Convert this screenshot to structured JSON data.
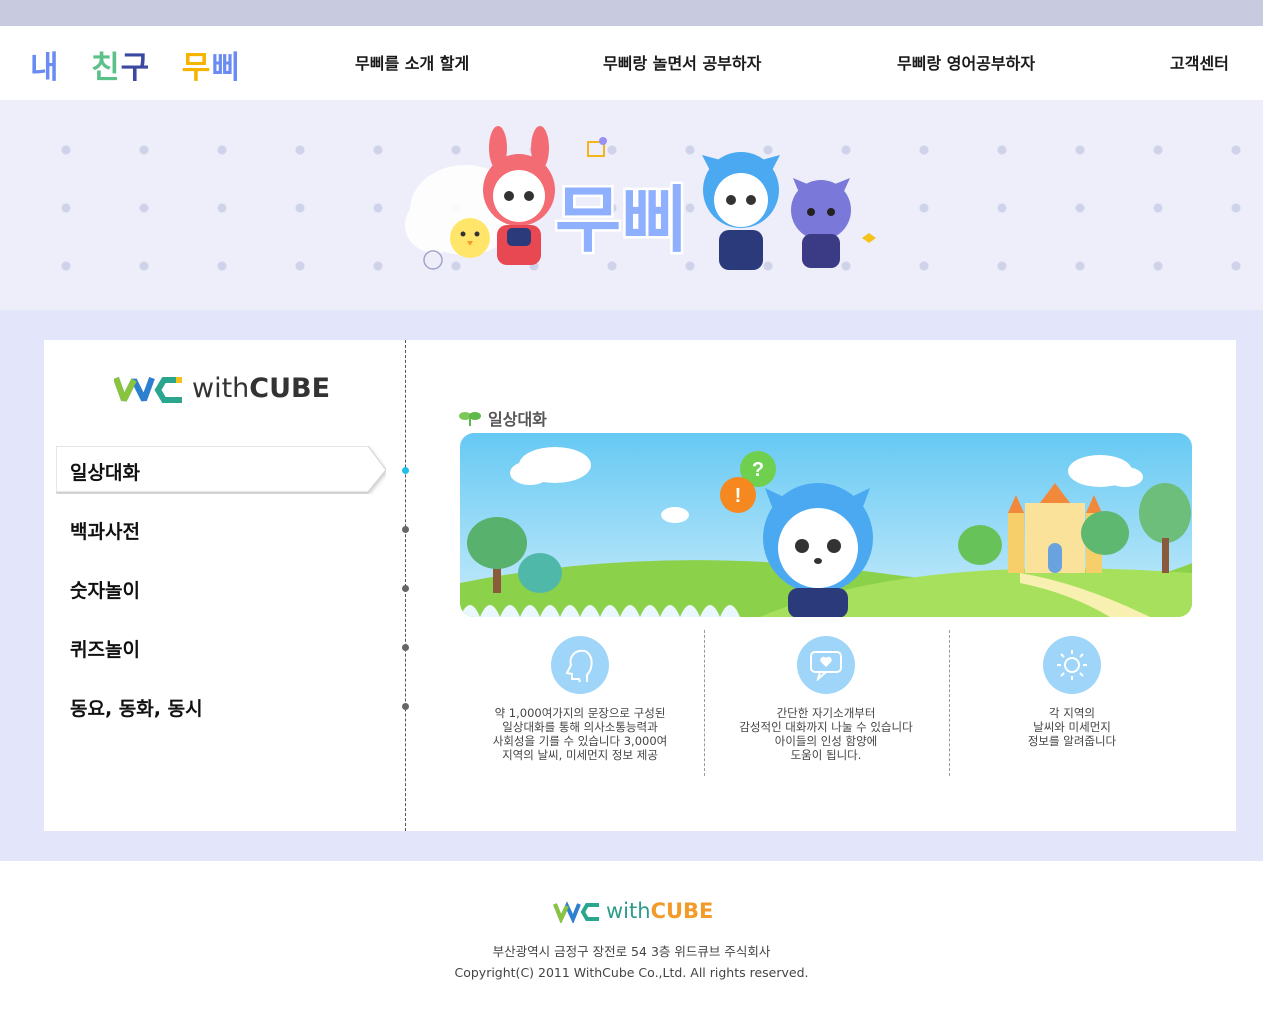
{
  "header": {
    "logo_parts": [
      "내",
      "친",
      "구",
      "무",
      "삐"
    ],
    "nav": [
      "무삐를 소개 할게",
      "무삐랑 놀면서 공부하자",
      "무삐랑 영어공부하자",
      "고객센터"
    ]
  },
  "hero": {
    "title": "무삐"
  },
  "sidebar": {
    "brand_prefix": "with",
    "brand_suffix": "CUBE",
    "items": [
      {
        "label": "일상대화",
        "active": true
      },
      {
        "label": "백과사전",
        "active": false
      },
      {
        "label": "숫자놀이",
        "active": false
      },
      {
        "label": "퀴즈놀이",
        "active": false
      },
      {
        "label": "동요, 동화, 동시",
        "active": false
      }
    ]
  },
  "content": {
    "section_title": "일상대화",
    "banner_bubbles": [
      "?",
      "!"
    ],
    "features": [
      {
        "icon": "face-profile-icon",
        "text": "약 1,000여가지의 문장으로 구성된\n일상대화를 통해 의사소통능력과\n사회성을 기를 수 있습니다 3,000여\n지역의 날씨, 미세먼지 정보 제공"
      },
      {
        "icon": "chat-heart-icon",
        "text": "간단한 자기소개부터\n감성적인 대화까지 나눌 수 있습니다\n아이들의 인성 함양에\n도움이 됩니다."
      },
      {
        "icon": "sun-icon",
        "text": "각 지역의\n날씨와 미세먼지\n정보를 알려줍니다"
      }
    ]
  },
  "footer": {
    "brand_prefix": "with",
    "brand_suffix": "CUBE",
    "address": "부산광역시 금정구 장전로 54 3층 위드큐브 주식회사",
    "copyright": "Copyright(C) 2011 WithCube Co.,Ltd. All rights reserved."
  },
  "colors": {
    "topbar": "#c8cbe0",
    "band": "#e3e6fb",
    "accent_blue": "#6a8cf2",
    "accent_dot": "#1ec0ea",
    "feature_circle": "#9fd5f8"
  }
}
